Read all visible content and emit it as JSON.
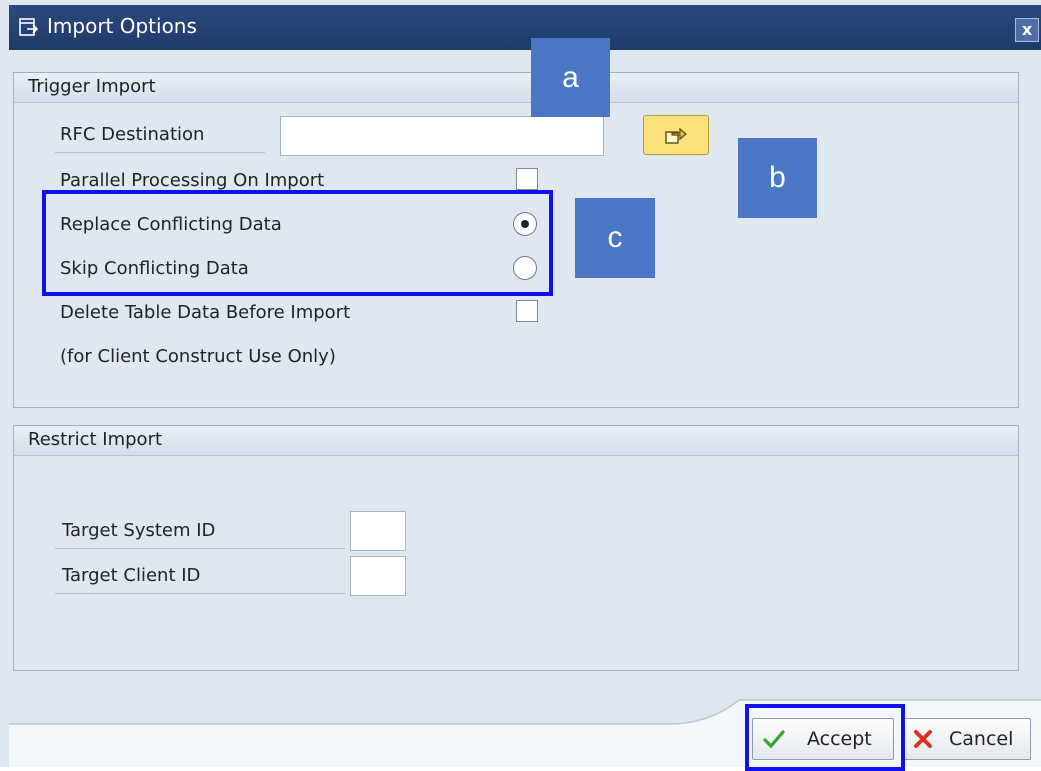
{
  "window": {
    "title": "Import Options",
    "close_label": "x"
  },
  "trigger_import": {
    "header": "Trigger Import",
    "rfc_destination_label": "RFC Destination",
    "rfc_destination_value": "",
    "parallel_processing_label": "Parallel Processing On Import",
    "parallel_processing_checked": false,
    "replace_conflicting_label": "Replace Conflicting Data",
    "replace_conflicting_selected": true,
    "skip_conflicting_label": "Skip Conflicting Data",
    "skip_conflicting_selected": false,
    "delete_table_label": "Delete Table Data Before Import",
    "delete_table_checked": false,
    "client_construct_note": "(for Client Construct Use Only)"
  },
  "restrict_import": {
    "header": "Restrict Import",
    "target_system_label": "Target System ID",
    "target_system_value": "",
    "target_client_label": "Target Client ID",
    "target_client_value": ""
  },
  "callouts": {
    "a": "a",
    "b": "b",
    "c": "c"
  },
  "footer": {
    "accept_label": "Accept",
    "cancel_label": "Cancel"
  },
  "colors": {
    "titlebar": "#1f3a68",
    "callout": "#4a76c4",
    "highlight": "#1010f0",
    "accept_check": "#3aa12e",
    "cancel_x": "#d9331c"
  }
}
